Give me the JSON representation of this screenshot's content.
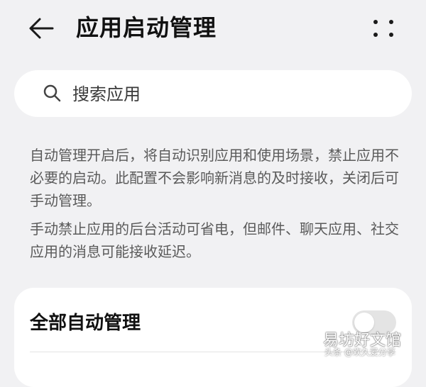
{
  "header": {
    "title": "应用启动管理",
    "back_icon": "arrow-left-icon",
    "more_icon": "more-dots-icon"
  },
  "search": {
    "placeholder": "搜索应用",
    "icon": "search-icon"
  },
  "description": {
    "paragraph_1": "自动管理开启后，将自动识别应用和使用场景，禁止应用不必要的启动。此配置不会影响新消息的及时接收，关闭后可手动管理。",
    "paragraph_2": "手动禁止应用的后台活动可省电，但邮件、聊天应用、社交应用的消息可能接收延迟。"
  },
  "settings": {
    "auto_manage_all": {
      "label": "全部自动管理",
      "enabled": false
    }
  },
  "watermark": {
    "main": "易坊好文馆",
    "sub": "头条 @欢久爱分享"
  },
  "colors": {
    "background": "#f1f1f3",
    "card": "#ffffff",
    "toggle_off": "#e4e4e4",
    "text_primary": "#111111",
    "text_secondary": "#5a5a5a"
  }
}
